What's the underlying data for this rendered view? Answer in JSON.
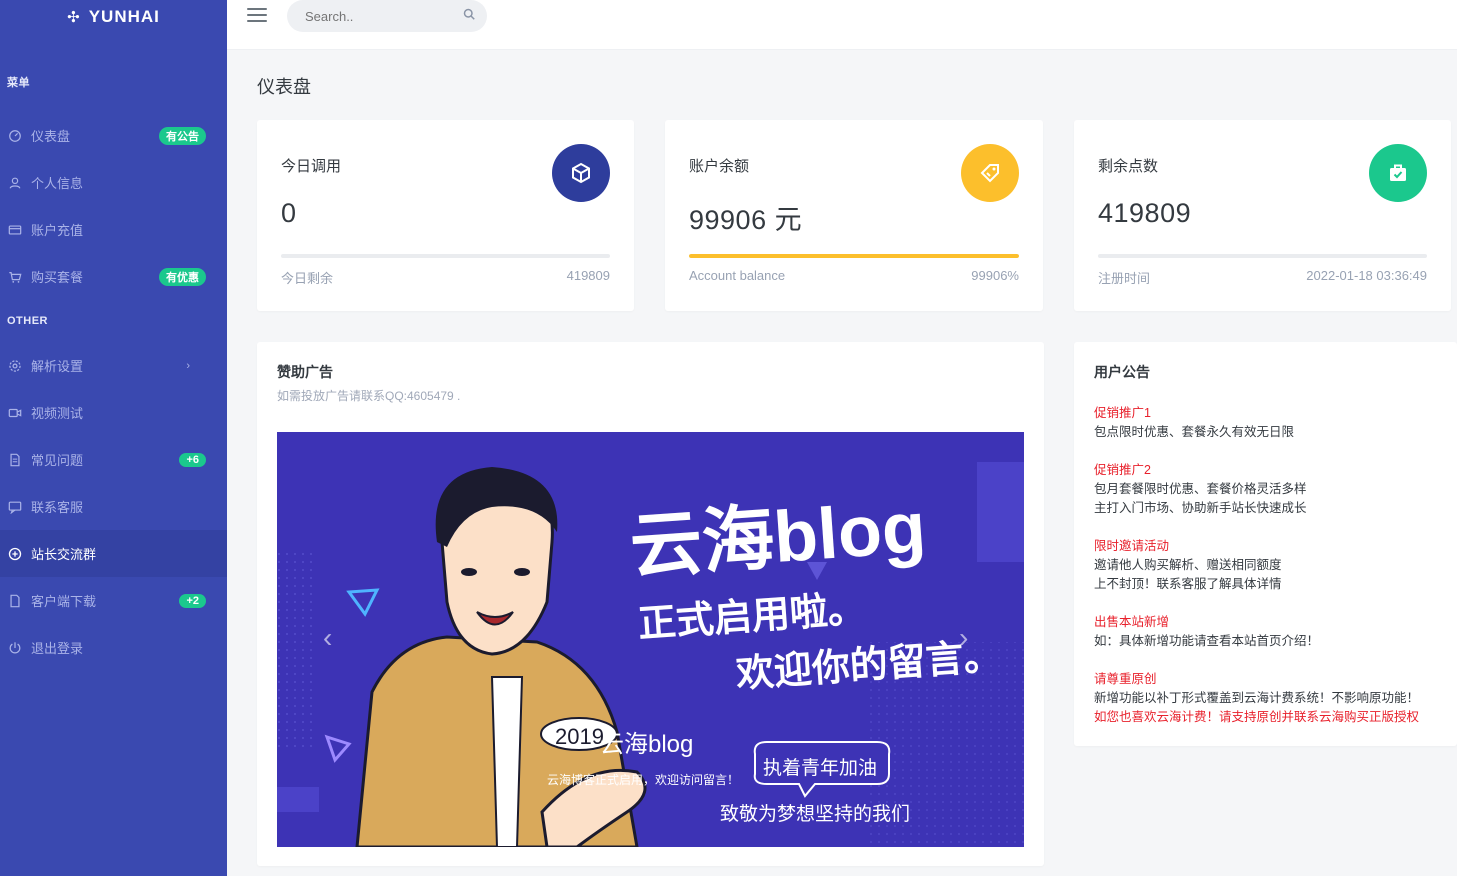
{
  "brand": {
    "name": "YUNHAI"
  },
  "sidebar": {
    "section1_title": "菜单",
    "section2_title": "OTHER",
    "items": [
      {
        "label": "仪表盘",
        "badge": "有公告"
      },
      {
        "label": "个人信息"
      },
      {
        "label": "账户充值"
      },
      {
        "label": "购买套餐",
        "badge": "有优惠"
      },
      {
        "label": "解析设置"
      },
      {
        "label": "视频测试"
      },
      {
        "label": "常见问题",
        "badge": "+6"
      },
      {
        "label": "联系客服"
      },
      {
        "label": "站长交流群"
      },
      {
        "label": "客户端下载",
        "badge": "+2"
      },
      {
        "label": "退出登录"
      }
    ]
  },
  "topbar": {
    "search_placeholder": "Search.."
  },
  "page": {
    "title": "仪表盘"
  },
  "stats": [
    {
      "label": "今日调用",
      "value": "0",
      "foot_left": "今日剩余",
      "foot_right": "419809",
      "color": "#2e3d9c",
      "progress": 0
    },
    {
      "label": "账户余额",
      "value": "99906 元",
      "foot_left": "Account balance",
      "foot_right": "99906%",
      "color": "#fcbf2c",
      "progress": 1
    },
    {
      "label": "剩余点数",
      "value": "419809",
      "foot_left": "注册时间",
      "foot_right": "2022-01-18 03:36:49",
      "color": "#1bc88d",
      "progress": 0
    }
  ],
  "ad": {
    "title": "赞助广告",
    "subtitle": "如需投放广告请联系QQ:4605479 .",
    "banner": {
      "headline": "云海blog",
      "line1": "正式启用啦。",
      "line2": "欢迎你的留言。",
      "year": "2019",
      "brand": "云海blog",
      "caption": "云海博客正式启用，欢迎访问留言！",
      "bubble": "执着青年加油",
      "slogan": "致敬为梦想坚持的我们",
      "bg_color": "#3d33b5"
    }
  },
  "notice": {
    "title": "用户公告",
    "items": [
      {
        "head": "促销推广1",
        "lines": [
          "包点限时优惠、套餐永久有效无日限"
        ]
      },
      {
        "head": "促销推广2",
        "lines": [
          "包月套餐限时优惠、套餐价格灵活多样",
          "主打入门市场、协助新手站长快速成长"
        ]
      },
      {
        "head": "限时邀请活动",
        "lines": [
          "邀请他人购买解析、赠送相同额度",
          "上不封顶！联系客服了解具体详情"
        ]
      },
      {
        "head": "出售本站新增",
        "lines": [
          "如：具体新增功能请查看本站首页介绍！"
        ]
      },
      {
        "head": "请尊重原创",
        "lines": [
          "新增功能以补丁形式覆盖到云海计费系统！不影响原功能！"
        ],
        "red_line": "如您也喜欢云海计费！请支持原创并联系云海购买正版授权"
      }
    ]
  }
}
